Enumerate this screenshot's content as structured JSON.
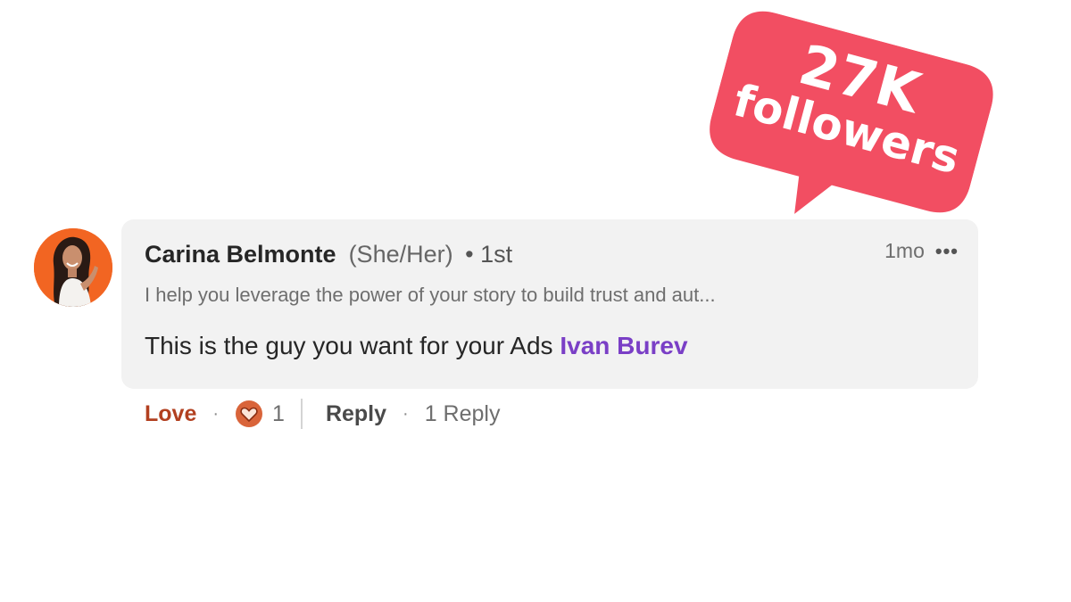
{
  "comment": {
    "author_name": "Carina Belmonte",
    "pronouns": "(She/Her)",
    "degree": "• 1st",
    "headline": "I help you leverage the power of your story to build trust and aut...",
    "text_prefix": "This is the guy you want for your Ads",
    "mention": "Ivan Burev",
    "timestamp": "1mo",
    "more_icon": "more-dots-icon"
  },
  "actions": {
    "love_label": "Love",
    "separator": "·",
    "reaction_icon": "heart-reaction-icon",
    "reaction_count": "1",
    "reply_label": "Reply",
    "reply_count": "1 Reply"
  },
  "sticker": {
    "count": "27K",
    "label": "followers"
  },
  "colors": {
    "sticker": "#f24e62",
    "mention": "#7a3fc6",
    "love": "#b24020",
    "avatar_bg": "#f26522",
    "bubble": "#f2f2f2"
  }
}
